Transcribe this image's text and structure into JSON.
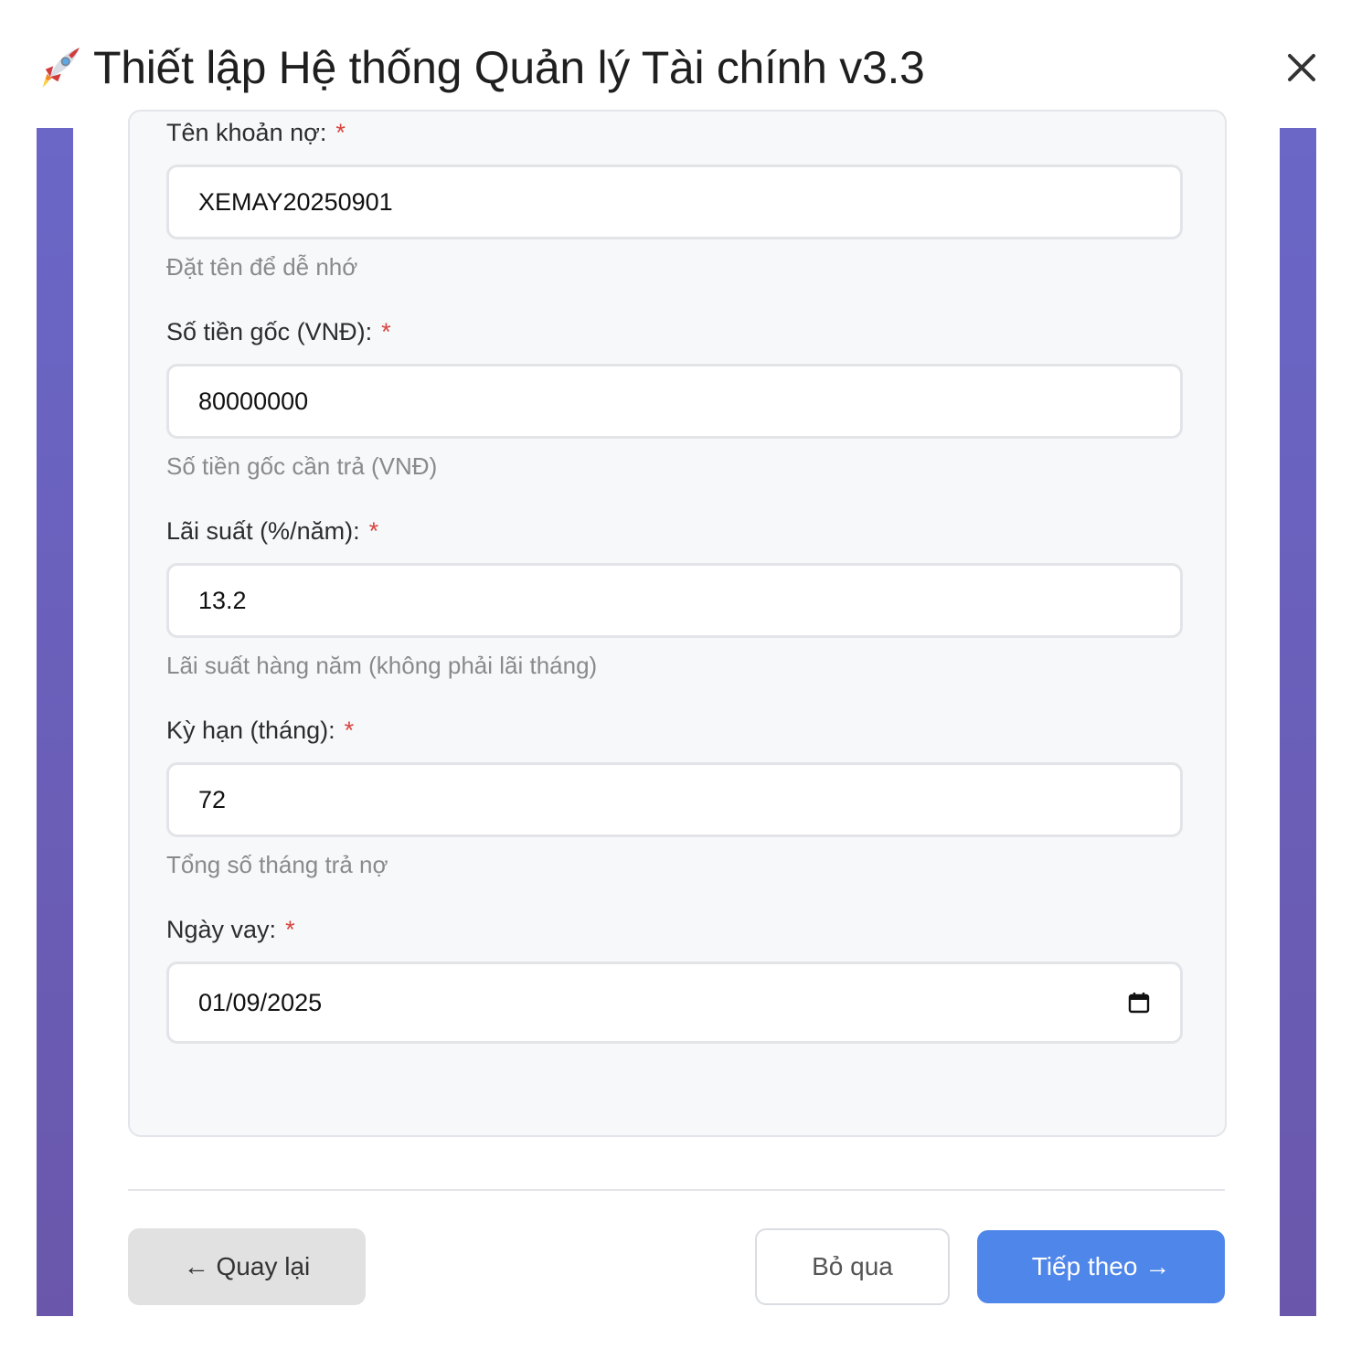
{
  "dialog": {
    "title": "Thiết lập Hệ thống Quản lý Tài chính v3.3",
    "title_icon": "rocket-icon",
    "close_icon": "close-icon"
  },
  "form": {
    "required_mark": "*",
    "fields": [
      {
        "label": "Tên khoản nợ:",
        "value": "XEMAY20250901",
        "help": "Đặt tên để dễ nhớ"
      },
      {
        "label": "Số tiền gốc (VNĐ):",
        "value": "80000000",
        "help": "Số tiền gốc cần trả (VNĐ)"
      },
      {
        "label": "Lãi suất (%/năm):",
        "value": "13.2",
        "help": "Lãi suất hàng năm (không phải lãi tháng)"
      },
      {
        "label": "Kỳ hạn (tháng):",
        "value": "72",
        "help": "Tổng số tháng trả nợ"
      },
      {
        "label": "Ngày vay:",
        "value": "01/09/2025",
        "icon": "calendar-icon"
      }
    ]
  },
  "footer": {
    "back_label": "← Quay lại",
    "skip_label": "Bỏ qua",
    "next_label": "Tiếp theo →"
  },
  "colors": {
    "accent": "#4f86ea",
    "required": "#d9443f",
    "side_band": "#6a62bd"
  }
}
